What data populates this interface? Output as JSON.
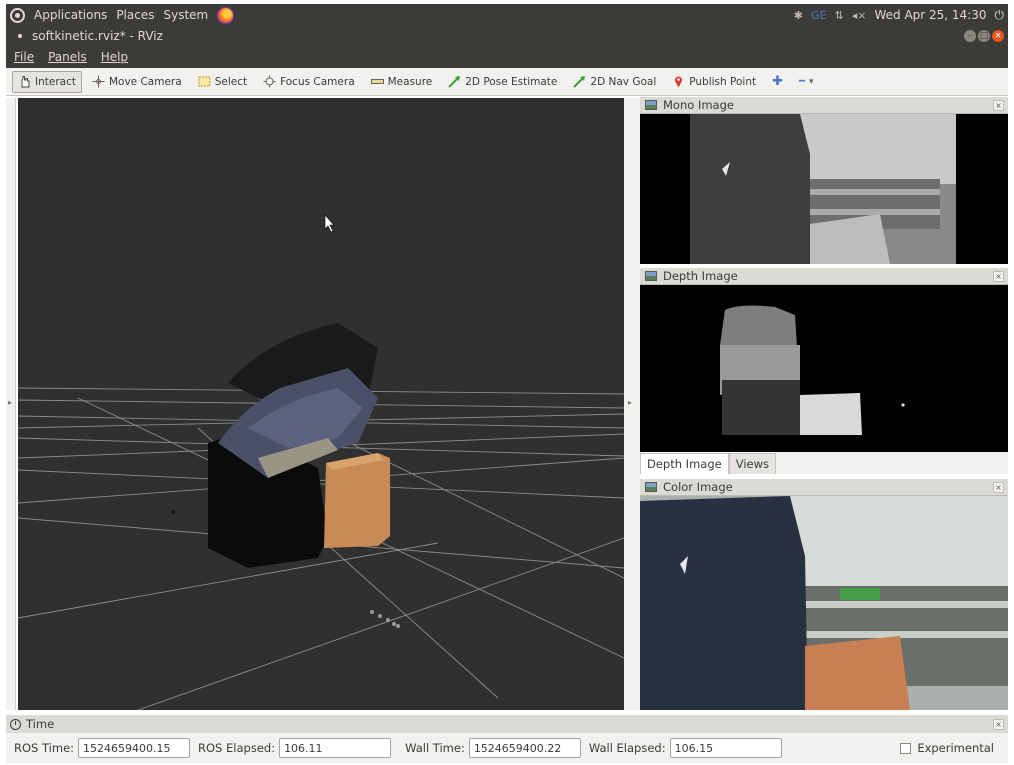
{
  "topbar": {
    "menus": [
      "Applications",
      "Places",
      "System"
    ],
    "indicators": [
      "✱",
      "GE",
      "⇅",
      "◂×"
    ],
    "datetime": "Wed Apr 25, 14:30",
    "power_icon": "⏻"
  },
  "window": {
    "title": "softkinetic.rviz* - RViz",
    "btn_min": "–",
    "btn_max": "□",
    "btn_close": "×"
  },
  "menubar": {
    "items": [
      "File",
      "Panels",
      "Help"
    ]
  },
  "toolbar": {
    "tools": [
      {
        "label": "Interact",
        "icon": "hand-icon"
      },
      {
        "label": "Move Camera",
        "icon": "move-camera-icon"
      },
      {
        "label": "Select",
        "icon": "select-icon"
      },
      {
        "label": "Focus Camera",
        "icon": "focus-camera-icon"
      },
      {
        "label": "Measure",
        "icon": "ruler-icon"
      },
      {
        "label": "2D Pose Estimate",
        "icon": "pose-arrow-icon"
      },
      {
        "label": "2D Nav Goal",
        "icon": "nav-arrow-icon"
      },
      {
        "label": "Publish Point",
        "icon": "map-pin-icon"
      }
    ],
    "add_icon": "✚",
    "remove_icon": "━",
    "dropdown_icon": "▾"
  },
  "panels": {
    "mono": {
      "title": "Mono Image",
      "close": "×"
    },
    "depth": {
      "title": "Depth Image",
      "close": "×"
    },
    "color": {
      "title": "Color Image",
      "close": "×"
    },
    "tabs": [
      "Depth Image",
      "Views"
    ]
  },
  "time": {
    "title": "Time",
    "close": "×",
    "ros_time_label": "ROS Time:",
    "ros_time": "1524659400.15",
    "ros_elapsed_label": "ROS Elapsed:",
    "ros_elapsed": "106.11",
    "wall_time_label": "Wall Time:",
    "wall_time": "1524659400.22",
    "wall_elapsed_label": "Wall Elapsed:",
    "wall_elapsed": "106.15",
    "experimental_label": "Experimental"
  },
  "colors": {
    "ubuntu_dark": "#3c3b37",
    "toolbar_bg": "#f2f1f0",
    "view_bg": "#303030",
    "accent_orange": "#e9541e",
    "cube_orange": "#c98a55"
  }
}
